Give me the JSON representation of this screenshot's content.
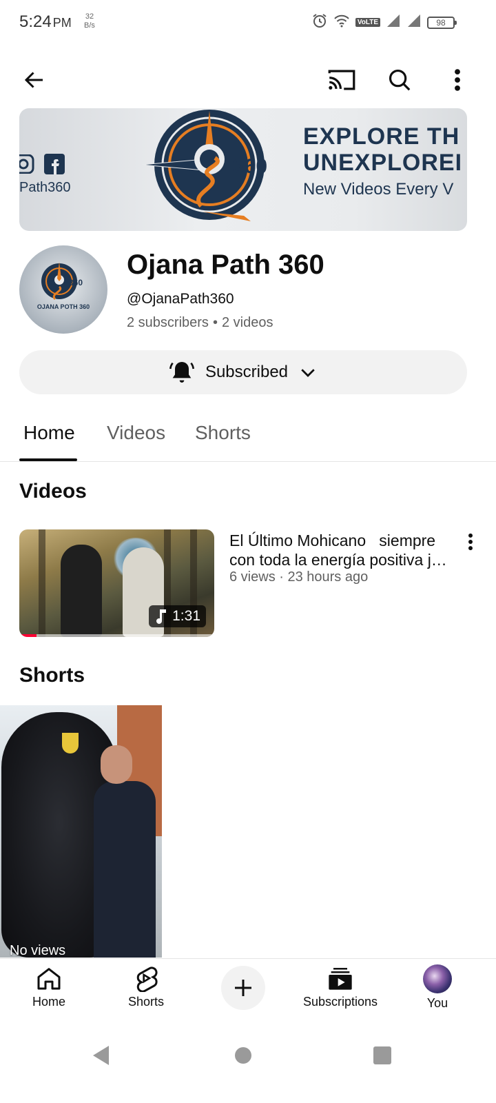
{
  "status_bar": {
    "time": "5:24",
    "ampm": "PM",
    "net_speed_value": "32",
    "net_speed_unit": "B/s",
    "volte": "VoLTE",
    "battery": "98"
  },
  "banner": {
    "handle_fragment": "Path360",
    "logo_text": "360",
    "tagline_line1": "EXPLORE TH",
    "tagline_line2": "UNEXPLOREI",
    "tagline_line3": "New Videos Every V"
  },
  "channel": {
    "avatar_text": "OJANA POTH 360",
    "avatar_logo_text": "360",
    "name": "Ojana Path 360",
    "handle": "@OjanaPath360",
    "subscribers": "2 subscribers",
    "separator": "•",
    "videos": "2 videos"
  },
  "subscribe_button": {
    "label": "Subscribed"
  },
  "tabs": [
    {
      "label": "Home",
      "active": true
    },
    {
      "label": "Videos",
      "active": false
    },
    {
      "label": "Shorts",
      "active": false
    }
  ],
  "sections": {
    "videos_title": "Videos",
    "shorts_title": "Shorts"
  },
  "video": {
    "title": "El Último Mohicano   siempre con toda la energía positiva j…",
    "meta": "6 views · 23 hours ago",
    "duration": "1:31",
    "watch_progress": 0.09
  },
  "short": {
    "views": "No views"
  },
  "bottom_nav": {
    "home": "Home",
    "shorts": "Shorts",
    "subscriptions": "Subscriptions",
    "you": "You"
  },
  "colors": {
    "accent_red": "#ff0033",
    "text_primary": "#0f0f0f",
    "text_secondary": "#606060",
    "chip_bg": "#f2f2f2",
    "banner_navy": "#1e3550",
    "banner_orange": "#e67e22"
  },
  "icons": {
    "back": "arrow-left-icon",
    "cast": "cast-icon",
    "search": "search-icon",
    "more": "more-vert-icon",
    "bell": "bell-icon",
    "chevron": "chevron-down-icon",
    "music": "music-note-icon",
    "home": "home-icon",
    "shorts": "shorts-icon",
    "create": "plus-icon",
    "subscriptions": "subscriptions-icon"
  }
}
